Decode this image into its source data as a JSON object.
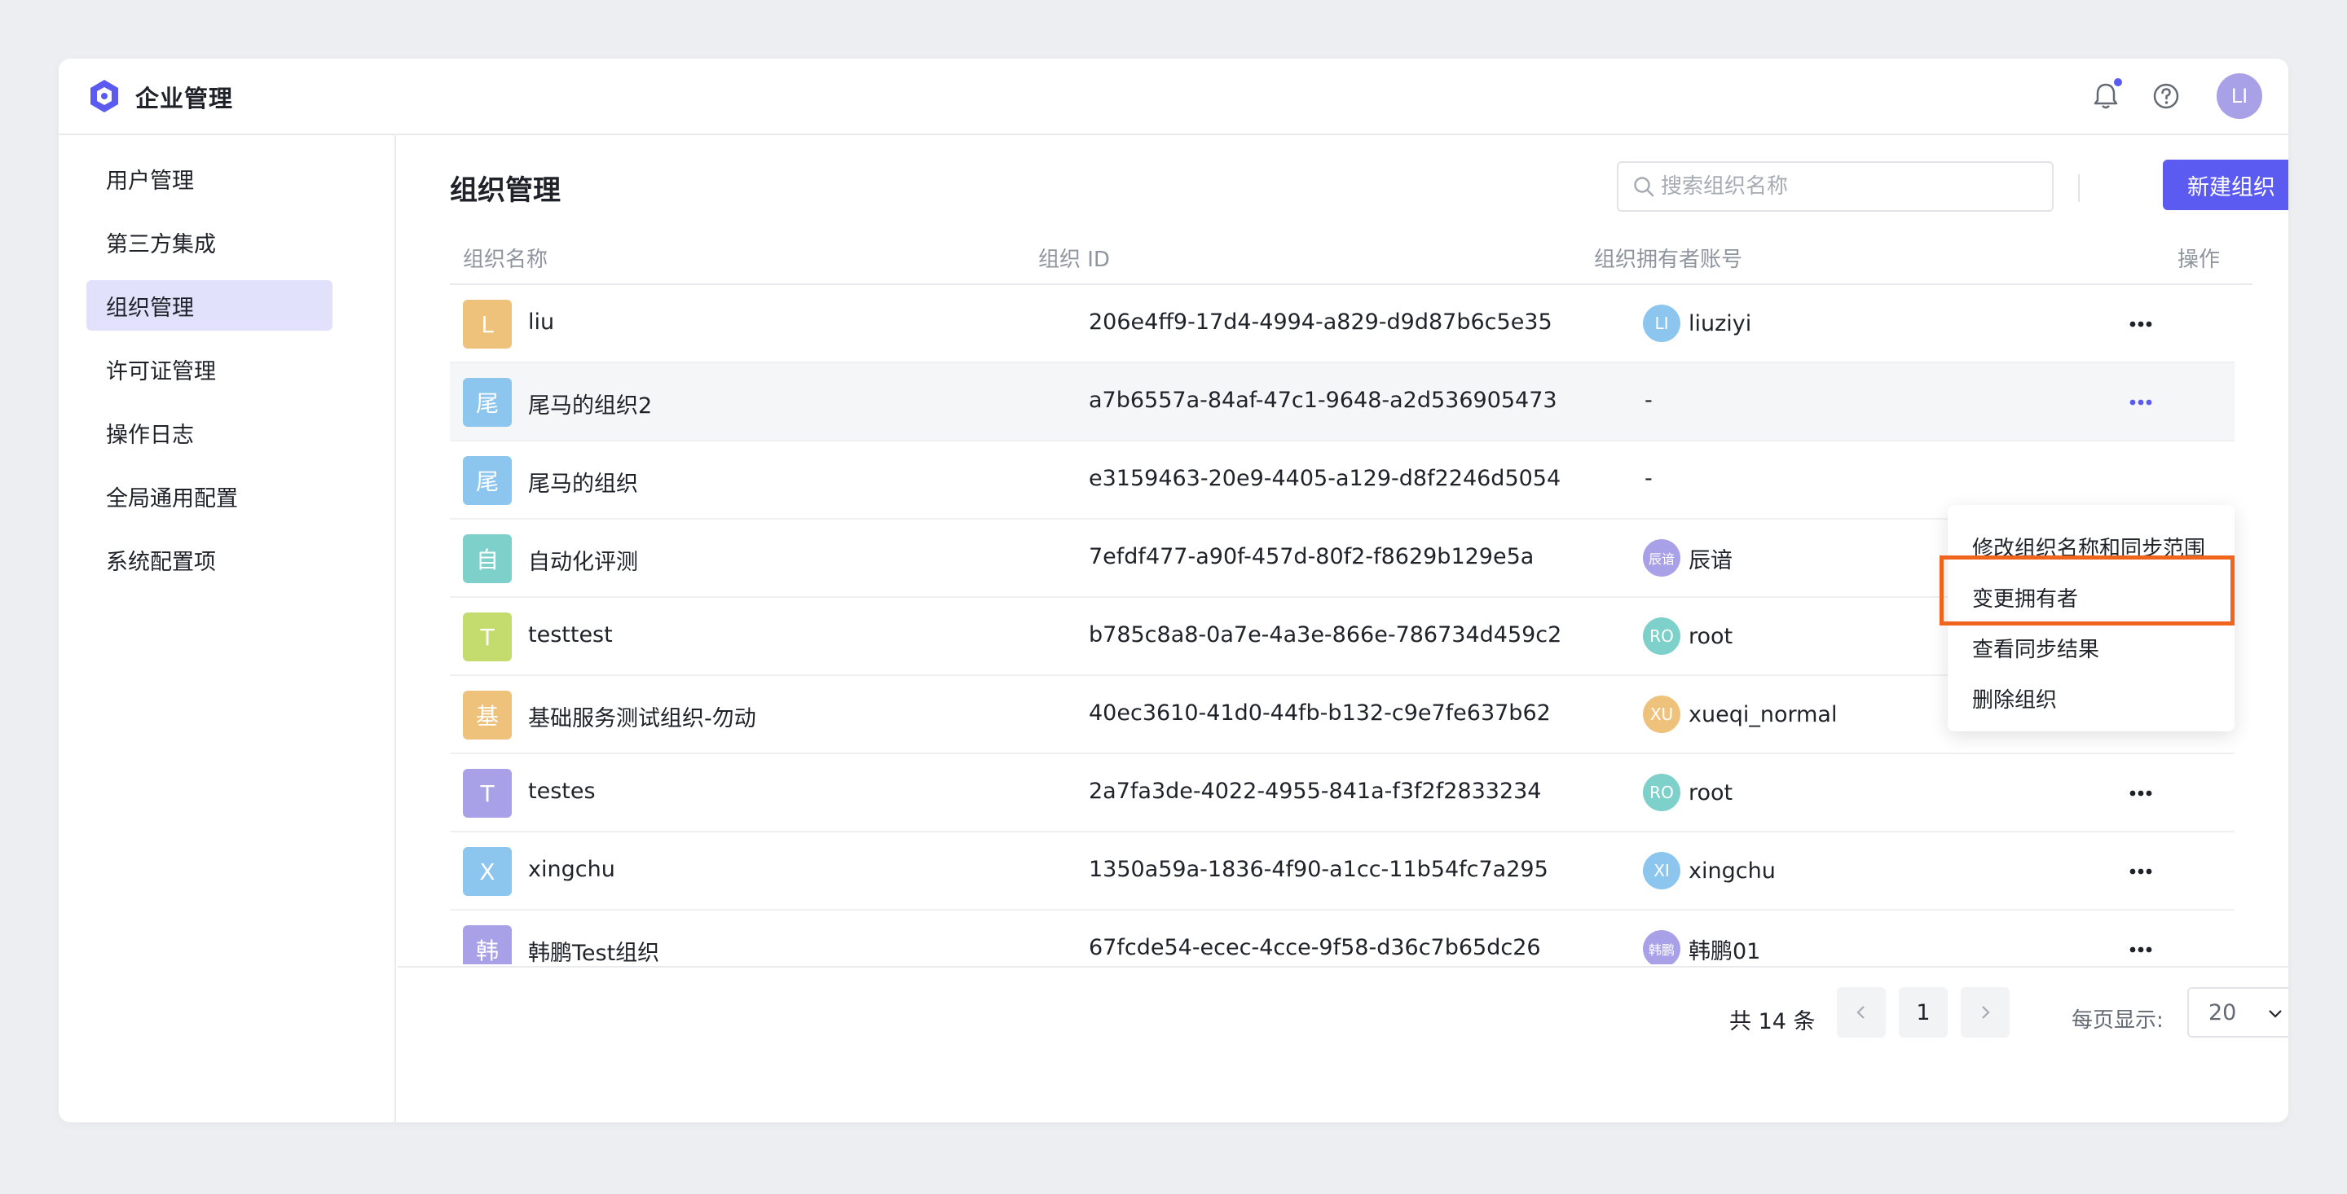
{
  "app": {
    "title": "企业管理"
  },
  "topbar": {
    "avatar": "LI"
  },
  "sidebar": {
    "items": [
      {
        "label": "用户管理"
      },
      {
        "label": "第三方集成"
      },
      {
        "label": "组织管理"
      },
      {
        "label": "许可证管理"
      },
      {
        "label": "操作日志"
      },
      {
        "label": "全局通用配置"
      },
      {
        "label": "系统配置项"
      }
    ]
  },
  "page": {
    "title": "组织管理",
    "search_placeholder": "搜索组织名称",
    "new_button": "新建组织"
  },
  "table": {
    "headers": {
      "name": "组织名称",
      "id": "组织 ID",
      "owner": "组织拥有者账号",
      "actions": "操作"
    },
    "rows": [
      {
        "icon": "L",
        "icon_color": "#EFC27B",
        "name": "liu",
        "id": "206e4ff9-17d4-4994-a829-d9d87b6c5e35",
        "owner_av": "LI",
        "owner_color": "#8CC6EE",
        "owner": "liuziyi"
      },
      {
        "icon": "尾",
        "icon_color": "#8CC6EE",
        "name": "尾马的组织2",
        "id": "a7b6557a-84af-47c1-9648-a2d536905473",
        "owner": "-"
      },
      {
        "icon": "尾",
        "icon_color": "#8CC6EE",
        "name": "尾马的组织",
        "id": "e3159463-20e9-4405-a129-d8f2246d5054",
        "owner": "-"
      },
      {
        "icon": "自",
        "icon_color": "#7ED0CB",
        "name": "自动化评测",
        "id": "7efdf477-a90f-457d-80f2-f8629b129e5a",
        "owner_av": "辰谙",
        "owner_color": "#A8A1E8",
        "owner": "辰谙"
      },
      {
        "icon": "T",
        "icon_color": "#C4DC6E",
        "name": "testtest",
        "id": "b785c8a8-0a7e-4a3e-866e-786734d459c2",
        "owner_av": "RO",
        "owner_color": "#7ED0CB",
        "owner": "root"
      },
      {
        "icon": "基",
        "icon_color": "#EFC27B",
        "name": "基础服务测试组织-勿动",
        "id": "40ec3610-41d0-44fb-b132-c9e7fe637b62",
        "owner_av": "XU",
        "owner_color": "#EFC27B",
        "owner": "xueqi_normal"
      },
      {
        "icon": "T",
        "icon_color": "#A8A1E8",
        "name": "testes",
        "id": "2a7fa3de-4022-4955-841a-f3f2f2833234",
        "owner_av": "RO",
        "owner_color": "#7ED0CB",
        "owner": "root"
      },
      {
        "icon": "X",
        "icon_color": "#8CC6EE",
        "name": "xingchu",
        "id": "1350a59a-1836-4f90-a1cc-11b54fc7a295",
        "owner_av": "XI",
        "owner_color": "#8CC6EE",
        "owner": "xingchu"
      },
      {
        "icon": "韩",
        "icon_color": "#A8A1E8",
        "name": "韩鹏Test组织",
        "id": "67fcde54-ecec-4cce-9f58-d36c7b65dc26",
        "owner_av": "韩鹏",
        "owner_color": "#A8A1E8",
        "owner": "韩鹏01"
      }
    ]
  },
  "menu": {
    "items": [
      {
        "label": "修改组织名称和同步范围"
      },
      {
        "label": "变更拥有者"
      },
      {
        "label": "查看同步结果"
      },
      {
        "label": "删除组织"
      }
    ]
  },
  "pagination": {
    "total": "共 14 条",
    "current_page": "1",
    "per_page_label": "每页显示:",
    "per_page": "20"
  },
  "colors": {
    "accent": "#5B5BF1",
    "highlight": "#F0651E",
    "active_nav_bg": "#E2E1FB"
  }
}
